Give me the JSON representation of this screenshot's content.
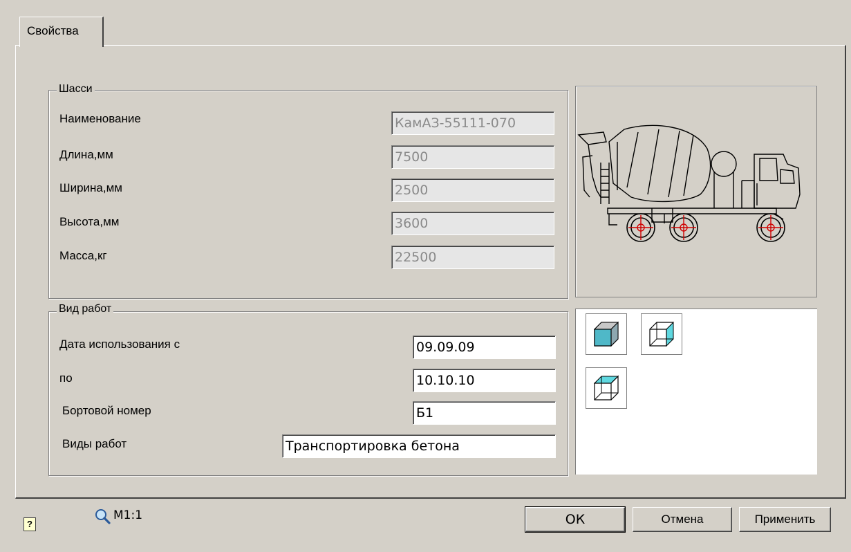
{
  "tabs": [
    {
      "label": "Свойства"
    }
  ],
  "chassis": {
    "legend": "Шасси",
    "rows": [
      {
        "label": "Наименование",
        "value": "КамАЗ-55111-070"
      },
      {
        "label": "Длина,мм",
        "value": "7500"
      },
      {
        "label": "Ширина,мм",
        "value": "2500"
      },
      {
        "label": "Высота,мм",
        "value": "3600"
      },
      {
        "label": "Масса,кг",
        "value": "22500"
      }
    ]
  },
  "work": {
    "legend": "Вид работ",
    "rows": [
      {
        "label": "Дата использования с",
        "value": "09.09.09"
      },
      {
        "label": "по",
        "value": "10.10.10"
      },
      {
        "label": "Бортовой номер",
        "value": "Б1"
      },
      {
        "label": "Виды работ",
        "value": "Транспортировка бетона"
      }
    ]
  },
  "view_icons": [
    "shaded-cube-icon",
    "wire-cube-right-face-icon",
    "wire-cube-top-face-icon"
  ],
  "footer": {
    "help_label": "?",
    "zoom_label": "М1:1",
    "ok_label": "ОК",
    "cancel_label": "Отмена",
    "apply_label": "Применить"
  },
  "colors": {
    "face_fill": "#4fb8c8",
    "face_light": "#5fd8e0",
    "wheel_center": "#d00000"
  }
}
